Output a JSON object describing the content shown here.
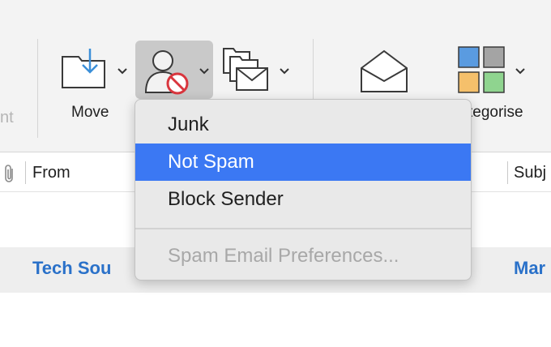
{
  "ribbon": {
    "partial_label_left": "nt",
    "move_label": "Move",
    "categorise_label": "tegorise",
    "icons": [
      "move-to-folder-icon",
      "block-sender-icon",
      "rules-icon",
      "read-unread-icon",
      "categorise-icon"
    ]
  },
  "columns": {
    "from_label": "From",
    "subject_label": "Subj",
    "attachment_icon": "paperclip-icon"
  },
  "message": {
    "sender_left": "Tech Sou",
    "sender_right": "Mar"
  },
  "junk_menu": {
    "items": [
      {
        "label": "Junk",
        "state": "normal"
      },
      {
        "label": "Not Spam",
        "state": "selected"
      },
      {
        "label": "Block Sender",
        "state": "normal"
      },
      {
        "label": "Spam Email Preferences...",
        "state": "disabled"
      }
    ]
  },
  "colors": {
    "ribbon_bg": "#f3f3f3",
    "selection_blue": "#3b78f3",
    "sender_blue": "#2a71c9",
    "icon_blue": "#3b8fd8",
    "block_red": "#d9363e",
    "category_blue": "#5a9be0",
    "category_gray": "#a4a4a4",
    "category_orange": "#f5c06b",
    "category_green": "#8fd48f"
  }
}
